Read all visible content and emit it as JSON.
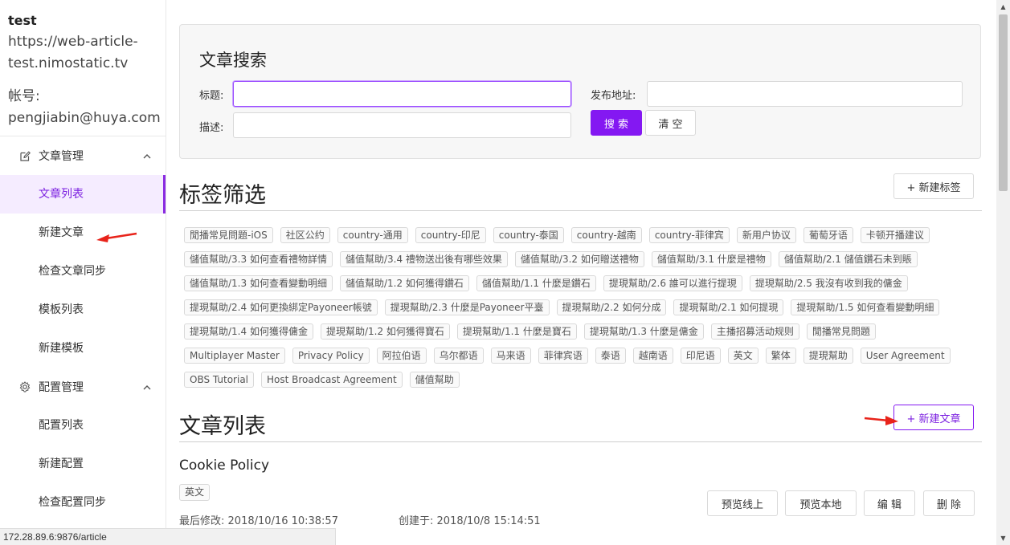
{
  "sidebar": {
    "user": {
      "name": "test",
      "url_line1": "https://web-article-",
      "url_line2": "test.nimostatic.tv",
      "account_label": "帐号:",
      "account_email": "pengjiabin@huya.com"
    },
    "groups": [
      {
        "icon": "edit-icon",
        "label": "文章管理",
        "items": [
          "文章列表",
          "新建文章",
          "检查文章同步",
          "模板列表",
          "新建模板"
        ]
      },
      {
        "icon": "gear-icon",
        "label": "配置管理",
        "items": [
          "配置列表",
          "新建配置",
          "检查配置同步"
        ]
      }
    ],
    "active_item": "文章列表"
  },
  "status_url": "172.28.89.6:9876/article",
  "search": {
    "title": "文章搜索",
    "title_label": "标题:",
    "desc_label": "描述:",
    "addr_label": "发布地址:",
    "title_value": "",
    "desc_value": "",
    "addr_value": "",
    "search_button": "搜 索",
    "clear_button": "清 空"
  },
  "tag_filter": {
    "title": "标签筛选",
    "new_tag_button": "+ 新建标签",
    "tags": [
      "閒播常見問題-iOS",
      "社区公约",
      "country-通用",
      "country-印尼",
      "country-泰国",
      "country-越南",
      "country-菲律宾",
      "新用户协议",
      "葡萄牙语",
      "卡顿开播建议",
      "儲值幫助/3.3 如何查看禮物詳情",
      "儲值幫助/3.4 禮物送出後有哪些效果",
      "儲值幫助/3.2 如何贈送禮物",
      "儲值幫助/3.1 什麼是禮物",
      "儲值幫助/2.1 儲值鑽石未到賬",
      "儲值幫助/1.3 如何查看變動明細",
      "儲值幫助/1.2 如何獲得鑽石",
      "儲值幫助/1.1 什麼是鑽石",
      "提現幫助/2.6 誰可以進行提現",
      "提現幫助/2.5 我沒有收到我的傭金",
      "提現幫助/2.4 如何更換綁定Payoneer帳號",
      "提現幫助/2.3 什麼是Payoneer平臺",
      "提現幫助/2.2 如何分成",
      "提現幫助/2.1 如何提現",
      "提現幫助/1.5 如何查看變動明細",
      "提現幫助/1.4 如何獲得傭金",
      "提現幫助/1.2 如何獲得寶石",
      "提現幫助/1.1 什麼是寶石",
      "提現幫助/1.3 什麼是傭金",
      "主播招募活动规则",
      "閒播常見問題",
      "Multiplayer Master",
      "Privacy Policy",
      "阿拉伯语",
      "乌尔都语",
      "马来语",
      "菲律宾语",
      "泰语",
      "越南语",
      "印尼语",
      "英文",
      "繁体",
      "提現幫助",
      "User Agreement",
      "OBS Tutorial",
      "Host Broadcast Agreement",
      "儲值幫助"
    ]
  },
  "article_list": {
    "title": "文章列表",
    "new_article_button": "+ 新建文章",
    "articles": [
      {
        "title": "Cookie Policy",
        "tag": "英文",
        "modified_label": "最后修改:",
        "modified": "2018/10/16 10:38:57",
        "created_label": "创建于:",
        "created": "2018/10/8 15:14:51",
        "actions": [
          "预览线上",
          "预览本地",
          "编 辑",
          "删 除"
        ]
      }
    ]
  },
  "colors": {
    "accent": "#8418f2",
    "active_bg": "#f5ecff",
    "arrow": "#e8231a"
  }
}
